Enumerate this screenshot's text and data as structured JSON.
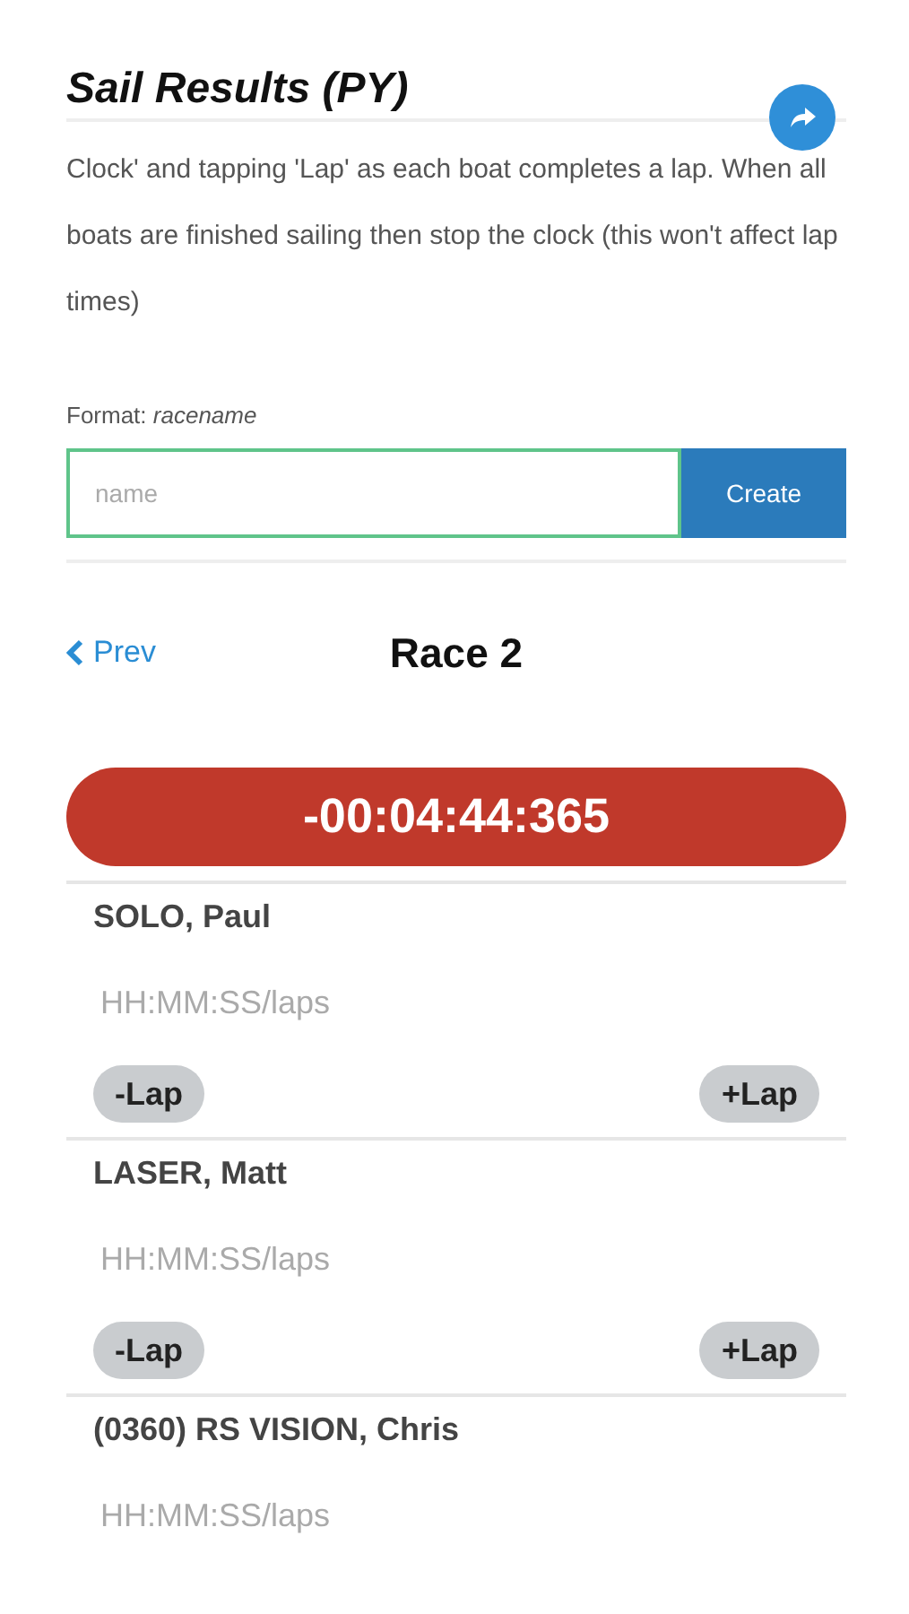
{
  "title": "Sail Results (PY)",
  "instructions": "Clock' and tapping 'Lap' as each boat completes a lap. When all boats are finished sailing then stop the clock (this won't affect lap times)",
  "format": {
    "label": "Format:",
    "value": "racename"
  },
  "name_field": {
    "placeholder": "name"
  },
  "create_button": "Create",
  "nav": {
    "prev": "Prev",
    "race": "Race 2"
  },
  "timer": "-00:04:44:365",
  "boats": [
    {
      "name": "SOLO, Paul",
      "placeholder": "HH:MM:SS/laps",
      "minus": "-Lap",
      "plus": "+Lap"
    },
    {
      "name": "LASER, Matt",
      "placeholder": "HH:MM:SS/laps",
      "minus": "-Lap",
      "plus": "+Lap"
    },
    {
      "name": "(0360) RS VISION, Chris",
      "placeholder": "HH:MM:SS/laps"
    }
  ]
}
